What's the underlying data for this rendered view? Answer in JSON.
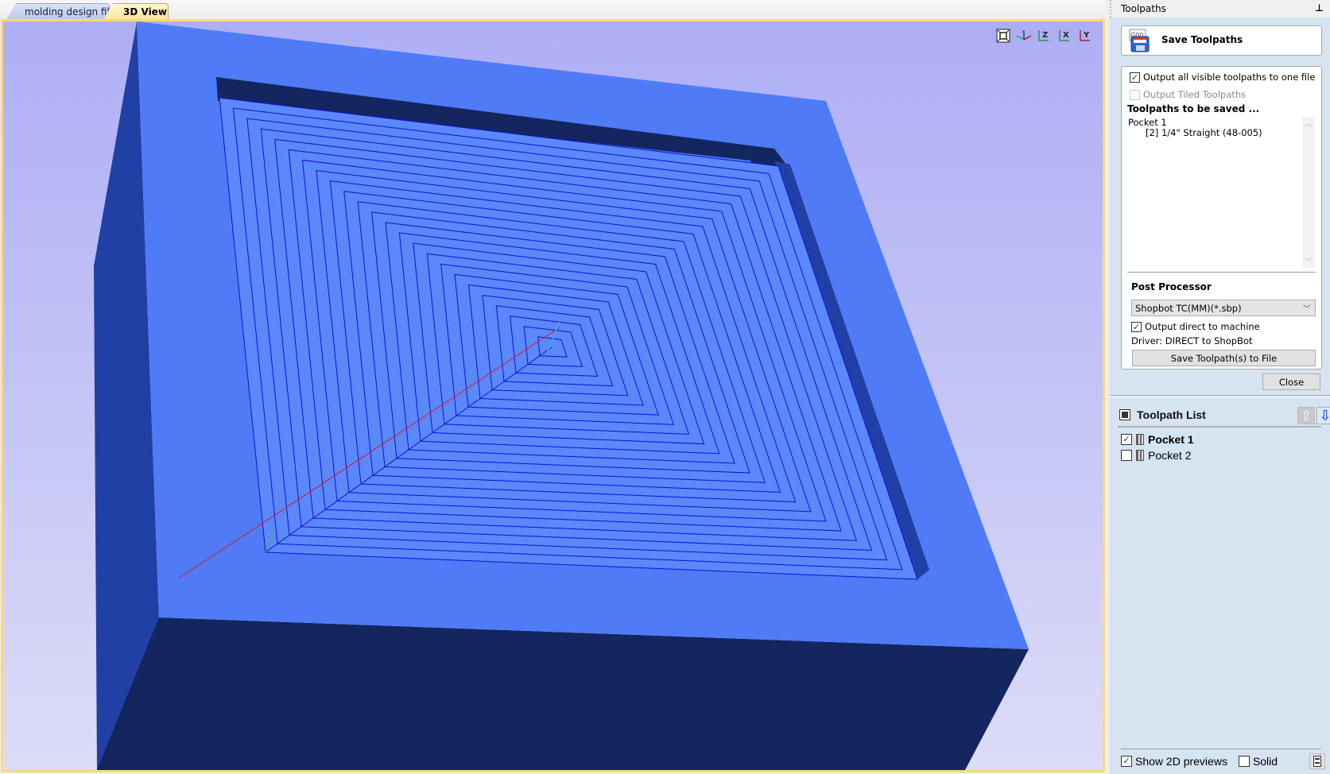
{
  "tabs": [
    {
      "label": "molding design file",
      "active": false
    },
    {
      "label": "3D View",
      "active": true
    }
  ],
  "view3d": {
    "toolbar": [
      {
        "name": "zoom-extents-icon",
        "label": ""
      },
      {
        "name": "iso-view-icon",
        "label": ""
      },
      {
        "name": "view-z-icon",
        "label": "Z"
      },
      {
        "name": "view-x-icon",
        "label": "X"
      },
      {
        "name": "view-y-icon",
        "label": "Y"
      }
    ],
    "colors": {
      "background_top": "#aeaef6",
      "background_bottom": "#dcdcf8",
      "material_top": "#4f7bf7",
      "material_side_left": "#2140a6",
      "material_front": "#14265f",
      "pocket_floor": "#5b88fb",
      "toolpath": "#1010d8",
      "x_axis": "#e01818",
      "y_axis": "#22c84a",
      "z_axis": "#22c8e8",
      "frame": "#ffd877"
    },
    "toolpath_rings": 24
  },
  "panel": {
    "title": "Toolpaths",
    "pin_icon": "pin-icon",
    "save_header": {
      "title": "Save Toolpaths",
      "icon": "save-gcode-icon"
    },
    "options": {
      "output_all_visible": {
        "label": "Output all visible toolpaths to one file",
        "checked": true
      },
      "output_tiled": {
        "label": "Output Tiled Toolpaths",
        "checked": false,
        "disabled": true
      },
      "to_be_saved_title": "Toolpaths to be saved ...",
      "to_be_saved": [
        {
          "name": "Pocket 1",
          "tool": "[2] 1/4\" Straight  (48-005)"
        }
      ],
      "post_processor_title": "Post Processor",
      "post_processor_value": "Shopbot TC(MM)(*.sbp)",
      "output_direct": {
        "label": "Output direct to machine",
        "checked": true
      },
      "driver_text": "Driver: DIRECT to ShopBot",
      "save_file_button": "Save Toolpath(s) to File"
    },
    "close_button": "Close",
    "toolpath_list": {
      "title": "Toolpath List",
      "items": [
        {
          "label": "Pocket 1",
          "checked": true,
          "bold": true
        },
        {
          "label": "Pocket 2",
          "checked": false,
          "bold": false
        }
      ]
    },
    "footer": {
      "show_2d_previews": {
        "label": "Show 2D previews",
        "checked": true
      },
      "solid": {
        "label": "Solid",
        "checked": false
      }
    }
  }
}
